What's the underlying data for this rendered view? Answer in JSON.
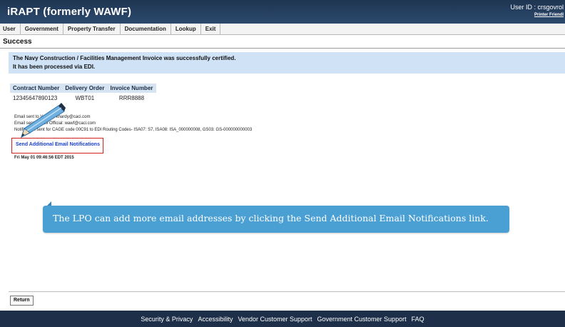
{
  "header": {
    "app_title": "iRAPT (formerly WAWF)",
    "user_id": "User ID : crsgovrol",
    "printer_friendly": "Printer Friendl"
  },
  "menu": {
    "items": [
      "User",
      "Government",
      "Property Transfer",
      "Documentation",
      "Lookup",
      "Exit"
    ]
  },
  "page": {
    "title": "Success",
    "message_line1": "The Navy Construction / Facilities Management Invoice was successfully certified.",
    "message_line2": "It has been processed via EDI."
  },
  "invoice_table": {
    "headers": [
      "Contract Number",
      "Delivery Order",
      "Invoice Number"
    ],
    "row": [
      "12345647890123",
      "WBT01",
      "RRR8888"
    ]
  },
  "notifications": {
    "line1": "Email sent to Vendor: khardy@caci.com",
    "line2": "Email sent to Gov Official: wawf@caci.com",
    "line3": "Notification sent for CAGE code 00C91 to EDI Routing Codes- ISA07: S7, ISA08: ISA_000000008, GS03: GS-000000000003",
    "send_link": "Send Additional Email Notifications",
    "timestamp": "Fri May 01 09:46:56 EDT 2015"
  },
  "callout": {
    "text": "The LPO can add more email addresses by clicking the Send Additional Email Notifications link."
  },
  "buttons": {
    "return_label": "Return"
  },
  "footer": {
    "links": [
      "Security & Privacy",
      "Accessibility",
      "Vendor Customer Support",
      "Government Customer Support",
      "FAQ"
    ]
  },
  "colors": {
    "header_bg": "#2c4a6e",
    "message_bg": "#cfe2f6",
    "callout_bg": "#4a9fd3",
    "link_color": "#1a3fd0",
    "highlight_border": "#cc2222"
  }
}
